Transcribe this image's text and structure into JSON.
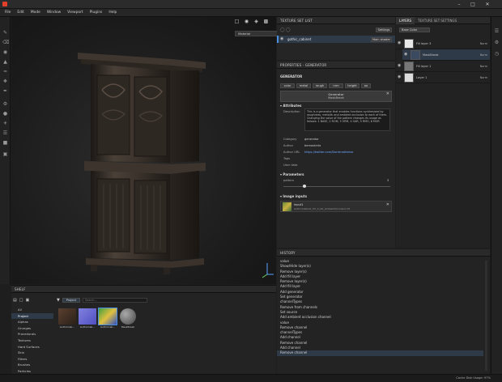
{
  "menu": [
    "File",
    "Edit",
    "Mode",
    "Window",
    "Viewport",
    "Plugins",
    "Help"
  ],
  "viewport": {
    "material_mode": "Material"
  },
  "texture_set_list": {
    "title": "TEXTURE SET LIST",
    "settings_label": "Settings",
    "item": "gothic_cabinet",
    "shader": "Main shader"
  },
  "properties": {
    "title": "PROPERTIES - GENERATOR",
    "section": "GENERATOR",
    "channels": [
      "color",
      "metal",
      "rough",
      "nrm",
      "height",
      "ao"
    ],
    "generator_label": "Generator",
    "generator_name": "MaskBreak",
    "attributes_title": "Attributes",
    "description_label": "Description",
    "description_text": "This is a generator that enables functions synthesized by roughness, metallic and ambient occlusion to each of them. Changing the value of the pattern changes its usage as follows: 1 BASE, 2 ROM, 3 ORM, 4 OAR, 5 RMO, 6 MOR",
    "category_label": "Category",
    "category_value": "generator",
    "author_label": "Author",
    "author_value": "bemasteria",
    "author_url_label": "Author URL",
    "author_url_value": "https://twitter.com/Dontmatterise",
    "tags_label": "Tags",
    "tags_value": "",
    "user_data_label": "User data",
    "user_data_value": "",
    "parameters_title": "Parameters",
    "pattern_label": "pattern",
    "pattern_value": "3",
    "pattern_fraction": 0.2,
    "image_inputs_title": "Image inputs",
    "input_name": "input1",
    "input_file": "GothicCabinet_UV_0_AO_AmbientOcclusion.tif"
  },
  "layers": {
    "tab_layers": "LAYERS",
    "tab_tss": "TEXTURE SET SETTINGS",
    "base_color": "Base Color",
    "rows": [
      {
        "name": "Fill layer 3",
        "blend": "Norm",
        "opacity": "100"
      },
      {
        "name": "MaskBreak",
        "blend": "Norm",
        "opacity": "100"
      },
      {
        "name": "Fill layer 1",
        "blend": "Norm",
        "opacity": "100"
      },
      {
        "name": "Layer 1",
        "blend": "Norm",
        "opacity": "100"
      }
    ]
  },
  "history": {
    "title": "HISTORY",
    "items": [
      "value",
      "Show/Hide layer(s)",
      "Remove layer(s)",
      "Add fill layer",
      "Remove layer(s)",
      "Add fill layer",
      "Add generator",
      "Set generator",
      "channelTypes",
      "Remove from channels",
      "Set source",
      "Add ambient occlusion channel",
      "value",
      "Remove channel",
      "channelTypes",
      "Add channel",
      "Remove channel",
      "Add channel",
      "Remove channel"
    ]
  },
  "shelf": {
    "title": "SHELF",
    "categories": [
      "All",
      "Project",
      "Alphas",
      "Grunges",
      "Procedurals",
      "Textures",
      "Hard Surfaces",
      "Skin",
      "Filters",
      "Brushes",
      "Particles"
    ],
    "selected_category": "Project",
    "filter_chip": "Project",
    "search_placeholder": "Search...",
    "items": [
      {
        "label": "GothicCab..."
      },
      {
        "label": "GothicCab..."
      },
      {
        "label": "GothicCab..."
      },
      {
        "label": "MaskBreak"
      }
    ]
  },
  "status": {
    "text": "Cache Disk Usage:",
    "value": "97%"
  }
}
